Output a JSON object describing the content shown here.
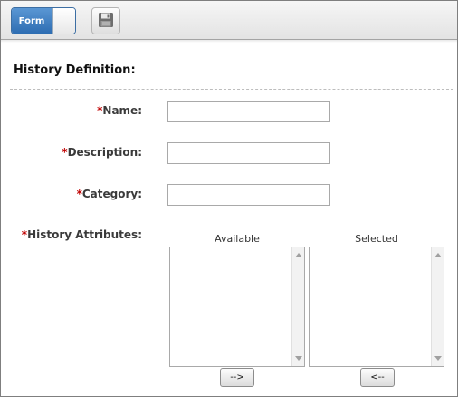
{
  "toolbar": {
    "form_toggle_label": "Form",
    "save_icon": "floppy-disk-icon"
  },
  "section": {
    "title": "History Definition:"
  },
  "fields": {
    "required_marker": "*",
    "name": {
      "label": "Name:",
      "value": ""
    },
    "description": {
      "label": "Description:",
      "value": ""
    },
    "category": {
      "label": "Category:",
      "value": ""
    },
    "history_attributes": {
      "label": "History Attributes:"
    }
  },
  "attributes": {
    "available_header": "Available",
    "selected_header": "Selected",
    "available_items": [],
    "selected_items": [],
    "add_button_label": "-->",
    "remove_button_label": "<--"
  },
  "colors": {
    "required": "#c00000",
    "toggle_active": "#2e6db2"
  }
}
